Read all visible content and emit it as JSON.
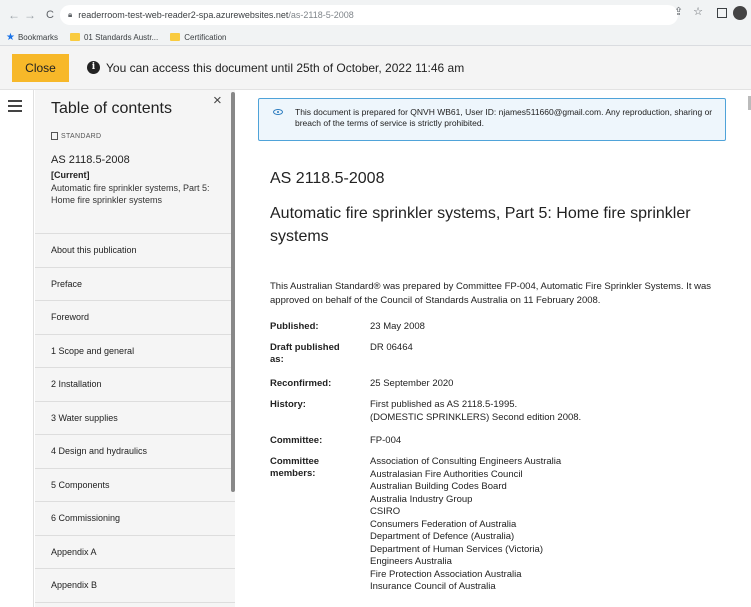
{
  "browser": {
    "url_host": "readerroom-test-web-reader2-spa.azurewebsites.net",
    "url_path": "/as-2118-5-2008",
    "bookmarks": [
      {
        "label": "Bookmarks"
      },
      {
        "label": "01 Standards Austr..."
      },
      {
        "label": "Certification"
      }
    ]
  },
  "notice": {
    "close_label": "Close",
    "info_glyph": "i",
    "message": "You can access this document until 25th of October, 2022 11:46 am"
  },
  "toc": {
    "title": "Table of contents",
    "close_glyph": "×",
    "badge": "STANDARD",
    "standard_id": "AS 2118.5-2008",
    "status": "[Current]",
    "standard_name": "Automatic fire sprinkler systems, Part 5: Home fire sprinkler systems",
    "items": [
      {
        "label": "About this publication"
      },
      {
        "label": "Preface"
      },
      {
        "label": "Foreword"
      },
      {
        "label": "1 Scope and general"
      },
      {
        "label": "2 Installation"
      },
      {
        "label": "3 Water supplies"
      },
      {
        "label": "4 Design and hydraulics"
      },
      {
        "label": "5 Components"
      },
      {
        "label": "6 Commissioning"
      },
      {
        "label": "Appendix A"
      },
      {
        "label": "Appendix B"
      }
    ]
  },
  "document": {
    "alert": "This document is prepared for QNVH WB61, User ID: njames511660@gmail.com. Any reproduction, sharing or breach of the terms of service is strictly prohibited.",
    "code": "AS 2118.5-2008",
    "title": "Automatic fire sprinkler systems, Part 5: Home fire sprinkler systems",
    "intro": "This Australian Standard® was prepared by Committee FP-004, Automatic Fire Sprinkler Systems. It was approved on behalf of the Council of Standards Australia on 11 February 2008.",
    "meta": {
      "published_key": "Published:",
      "published_val": "23 May 2008",
      "draft_key": "Draft published as:",
      "draft_val": "DR 06464",
      "reconfirmed_key": "Reconfirmed:",
      "reconfirmed_val": "25 September 2020",
      "history_key": "History:",
      "history_val_1": "First published as AS 2118.5-1995.",
      "history_val_2": "(DOMESTIC SPRINKLERS) Second edition 2008.",
      "committee_key": "Committee:",
      "committee_val": "FP-004",
      "members_key": "Committee members:",
      "members": [
        "Association of Consulting Engineers Australia",
        "Australasian Fire Authorities Council",
        "Australian Building Codes Board",
        "Australia Industry Group",
        "CSIRO",
        "Consumers Federation of Australia",
        "Department of Defence (Australia)",
        "Department of Human Services (Victoria)",
        "Engineers Australia",
        "Fire Protection Association Australia",
        "Insurance Council of Australia"
      ]
    }
  }
}
